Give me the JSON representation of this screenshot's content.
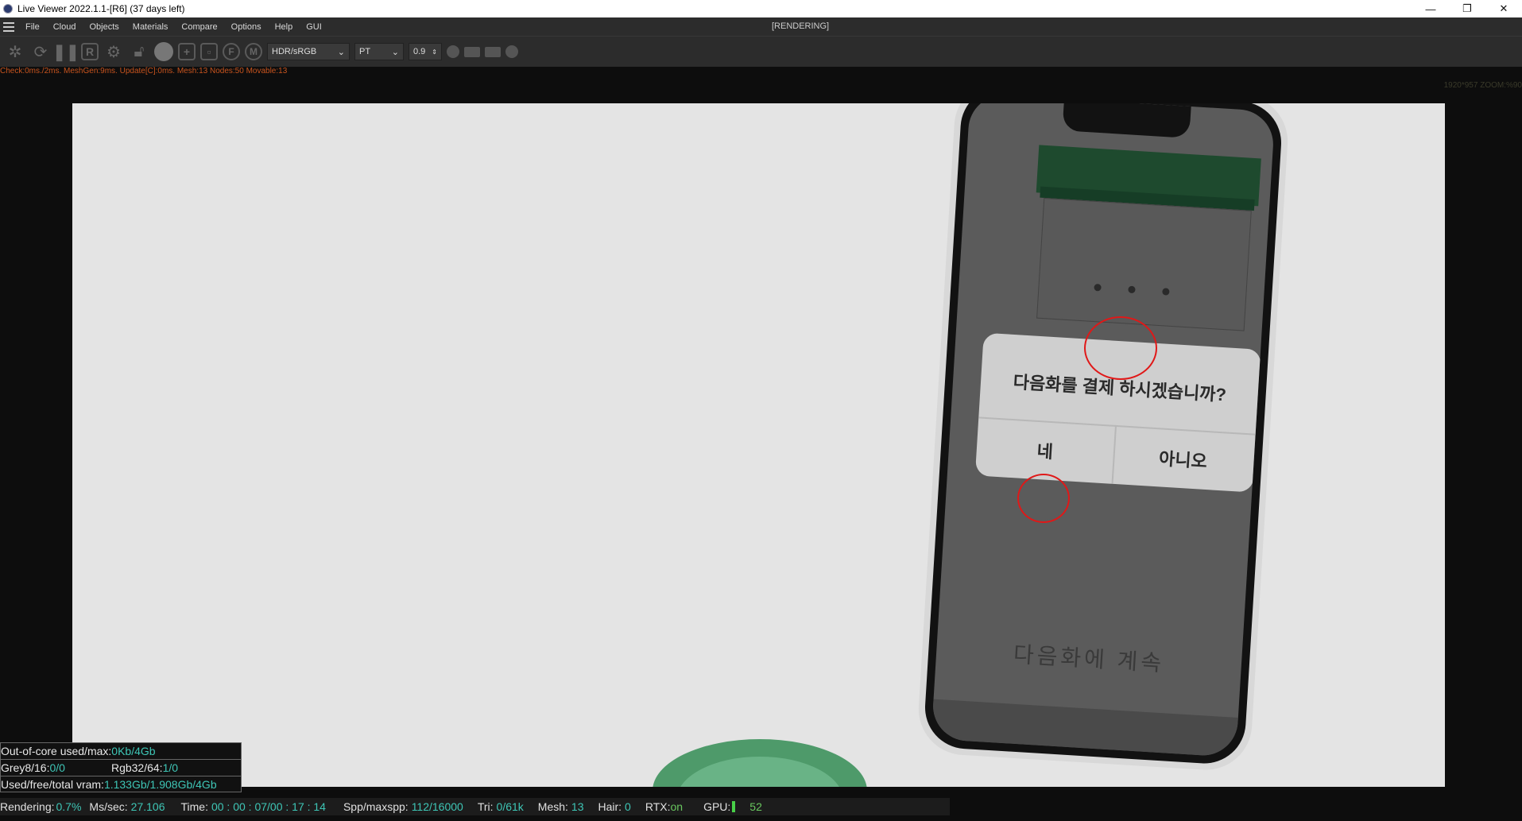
{
  "window": {
    "title": "Live Viewer 2022.1.1-[R6] (37 days left)",
    "minimize_glyph": "—",
    "restore_glyph": "❐",
    "close_glyph": "✕"
  },
  "menu": {
    "items": [
      "File",
      "Cloud",
      "Objects",
      "Materials",
      "Compare",
      "Options",
      "Help",
      "GUI"
    ],
    "status": "[RENDERING]"
  },
  "toolbar": {
    "icons": [
      "settings-icon",
      "refresh-icon",
      "pause-icon",
      "region-render-icon",
      "gear-icon",
      "lock-icon",
      "sphere-icon",
      "add-box-icon",
      "focus-box-icon",
      "focus-pick-icon",
      "material-pick-icon"
    ],
    "r_label": "R",
    "f_label": "F",
    "m_label": "M",
    "colorspace": "HDR/sRGB",
    "kernel": "PT",
    "value": "0.9"
  },
  "stats_top": "Check:0ms./2ms. MeshGen:9ms. Update[C]:0ms. Mesh:13 Nodes:50 Movable:13",
  "zoom_info": "1920*957 ZOOM:%90",
  "scene": {
    "dialog_message": "다음화를 결제 하시겠습니까?",
    "yes_label": "네",
    "no_label": "아니오",
    "continue_text": "다음화에 계속"
  },
  "info_panel": {
    "ooc_label": "Out-of-core used/max:",
    "ooc_value": "0Kb/4Gb",
    "grey_label": "Grey8/16: ",
    "grey_value": "0/0",
    "rgb_label": "Rgb32/64: ",
    "rgb_value": "1/0",
    "vram_label": "Used/free/total vram: ",
    "vram_value": "1.133Gb/1.908Gb/4Gb"
  },
  "statusbar": {
    "rendering_label": "Rendering:",
    "rendering_value": "0.7%",
    "mssec_label": "Ms/sec:",
    "mssec_value": "27.106",
    "time_label": "Time:",
    "time_value": "00 : 00 : 07/00 : 17 : 14",
    "spp_label": "Spp/maxspp:",
    "spp_value": "112/16000",
    "tri_label": "Tri:",
    "tri_value": "0/61k",
    "mesh_label": "Mesh:",
    "mesh_value": "13",
    "hair_label": "Hair:",
    "hair_value": "0",
    "rtx_label": "RTX:",
    "rtx_value": "on",
    "gpu_label": "GPU:",
    "gpu_value": "52"
  }
}
